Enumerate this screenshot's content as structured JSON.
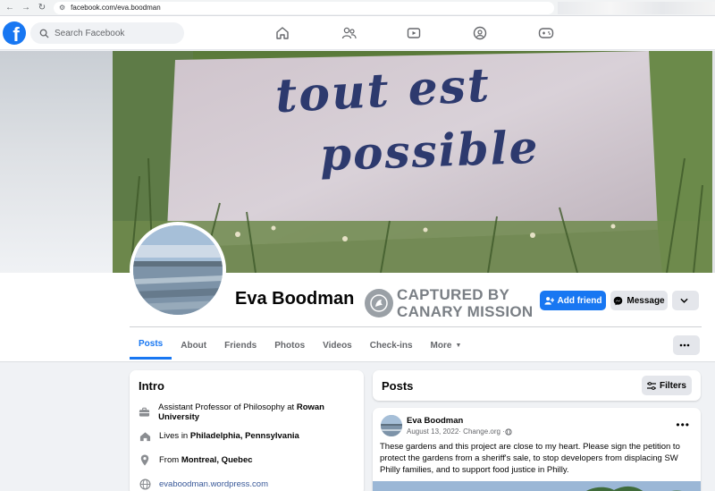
{
  "browser": {
    "url": "facebook.com/eva.boodman"
  },
  "fb_nav": {
    "logo": "f",
    "search_placeholder": "Search Facebook",
    "icons": [
      "home-icon",
      "friends-icon",
      "watch-icon",
      "groups-icon",
      "gaming-icon"
    ]
  },
  "cover": {
    "line1": "tout est",
    "line2": "possible"
  },
  "profile": {
    "name": "Eva Boodman",
    "stamp_line1": "CAPTURED BY",
    "stamp_line2": "CANARY MISSION",
    "add_friend": "Add friend",
    "message": "Message"
  },
  "tabs": [
    "Posts",
    "About",
    "Friends",
    "Photos",
    "Videos",
    "Check-ins",
    "More"
  ],
  "intro": {
    "title": "Intro",
    "work_prefix": "Assistant Professor of Philosophy at ",
    "work_place": "Rowan University",
    "lives_prefix": "Lives in ",
    "lives_place": "Philadelphia, Pennsylvania",
    "from_prefix": "From ",
    "from_place": "Montreal, Quebec",
    "website": "evaboodman.wordpress.com"
  },
  "posts": {
    "title": "Posts",
    "filters": "Filters",
    "items": [
      {
        "author": "Eva Boodman",
        "date": "August 13, 2022",
        "source": " · Change.org · ",
        "body": "These gardens and this project are close to my heart. Please sign the petition to protect the gardens from a sheriff's sale, to stop developers from displacing SW Philly families, and to support food justice in Philly."
      }
    ]
  },
  "colors": {
    "fb_blue": "#1877f2",
    "page_bg": "#f0f2f5",
    "button_grey": "#e4e6eb",
    "secondary_text": "#65676b"
  }
}
